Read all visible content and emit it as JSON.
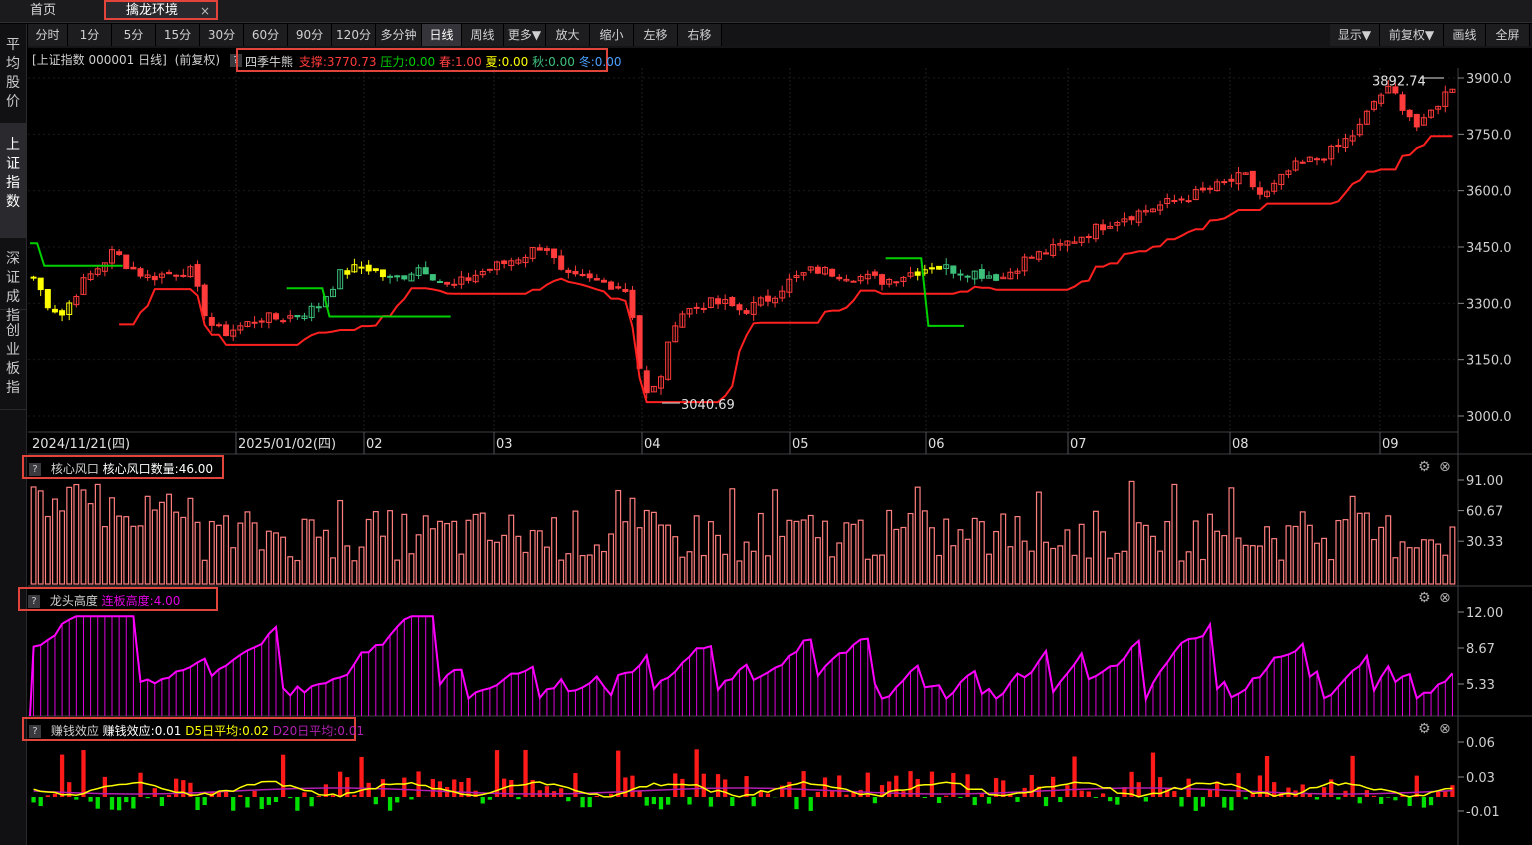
{
  "tabs": {
    "home": "首页",
    "active": "擒龙环境",
    "close": "×"
  },
  "toolbar_left": [
    "分时",
    "1分",
    "5分",
    "15分",
    "30分",
    "60分",
    "90分",
    "120分",
    "多分钟",
    "日线",
    "周线",
    "更多▼",
    "放大",
    "缩小",
    "左移",
    "右移"
  ],
  "toolbar_active": "日线",
  "toolbar_right": [
    "显示▼",
    "前复权▼",
    "画线",
    "全屏"
  ],
  "sidebar": [
    "平均股价",
    "上证指数",
    "深证成指",
    "创业板指"
  ],
  "sidebar_active": "上证指数",
  "main_panel": {
    "title": "[上证指数 000001 日线]",
    "adjust": "(前复权)",
    "indicator": "四季牛熊",
    "support": "支撑:3770.73",
    "pressure": "压力:0.00",
    "spring": "春:1.00",
    "summer": "夏:0.00",
    "autumn": "秋:0.00",
    "winter": "冬:0.00",
    "high_label": "3892.74",
    "low_label": "3040.69",
    "date_start": "2024/11/21(四)",
    "date_year": "2025/01/02(四)",
    "month_labels": [
      "02",
      "03",
      "04",
      "05",
      "06",
      "07",
      "08",
      "09"
    ],
    "y_ticks": [
      "3900.0",
      "3750.0",
      "3600.0",
      "3450.0",
      "3300.0",
      "3150.0",
      "3000.0"
    ]
  },
  "panel1": {
    "name": "核心风口",
    "value": "核心风口数量:46.00",
    "y_ticks": [
      "91.00",
      "60.67",
      "30.33"
    ]
  },
  "panel2": {
    "name": "龙头高度",
    "value": "连板高度:4.00",
    "y_ticks": [
      "12.00",
      "8.67",
      "5.33"
    ]
  },
  "panel3": {
    "name": "赚钱效应",
    "value": "赚钱效应:0.01",
    "d5": "D5日平均:0.02",
    "d20": "D20日平均:0.01",
    "y_ticks": [
      "0.06",
      "0.03",
      "-0.01"
    ]
  },
  "colors": {
    "up": "#ff3b3b",
    "down": "#ffff00",
    "green": "#00d000",
    "magenta": "#e000e0",
    "pink": "#ff7f7f"
  },
  "chart_data": {
    "type": "candlestick",
    "ylim": [
      3000,
      3900
    ],
    "n_bars": 200,
    "anchors": [
      [
        0,
        3370
      ],
      [
        3,
        3300
      ],
      [
        6,
        3270
      ],
      [
        10,
        3350
      ],
      [
        14,
        3400
      ],
      [
        17,
        3440
      ],
      [
        20,
        3400
      ],
      [
        24,
        3370
      ],
      [
        29,
        3380
      ],
      [
        33,
        3390
      ],
      [
        35,
        3320
      ],
      [
        37,
        3250
      ],
      [
        40,
        3220
      ],
      [
        44,
        3240
      ],
      [
        48,
        3260
      ],
      [
        52,
        3260
      ],
      [
        56,
        3270
      ],
      [
        60,
        3290
      ],
      [
        65,
        3380
      ],
      [
        70,
        3400
      ],
      [
        76,
        3360
      ],
      [
        82,
        3400
      ],
      [
        88,
        3340
      ],
      [
        94,
        3380
      ],
      [
        98,
        3400
      ],
      [
        104,
        3430
      ],
      [
        108,
        3460
      ],
      [
        112,
        3370
      ],
      [
        118,
        3360
      ],
      [
        123,
        3350
      ],
      [
        126,
        3330
      ],
      [
        129,
        3050
      ],
      [
        132,
        3080
      ],
      [
        136,
        3270
      ],
      [
        142,
        3300
      ],
      [
        146,
        3300
      ],
      [
        150,
        3280
      ],
      [
        155,
        3310
      ],
      [
        160,
        3360
      ],
      [
        165,
        3390
      ],
      [
        170,
        3380
      ],
      [
        180,
        3360
      ],
      [
        185,
        3380
      ],
      [
        190,
        3400
      ],
      [
        195,
        3390
      ],
      [
        205,
        3370
      ],
      [
        210,
        3420
      ],
      [
        215,
        3440
      ],
      [
        220,
        3470
      ],
      [
        228,
        3520
      ],
      [
        238,
        3560
      ],
      [
        248,
        3600
      ],
      [
        256,
        3640
      ],
      [
        260,
        3580
      ],
      [
        266,
        3660
      ],
      [
        274,
        3700
      ],
      [
        280,
        3760
      ],
      [
        284,
        3850
      ],
      [
        287,
        3870
      ],
      [
        291,
        3800
      ],
      [
        293,
        3760
      ],
      [
        296,
        3820
      ],
      [
        300,
        3880
      ]
    ]
  }
}
